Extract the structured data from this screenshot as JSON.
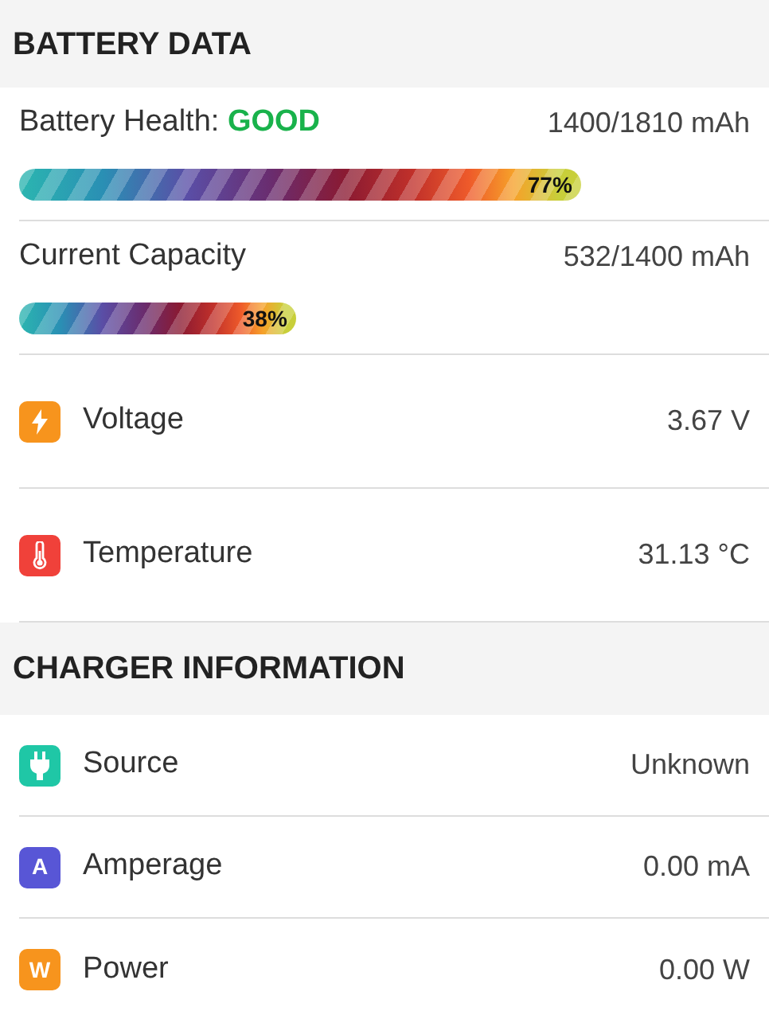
{
  "sections": [
    {
      "title": "BATTERY DATA",
      "rows": [
        {
          "kind": "meter",
          "label": "Battery Health:",
          "status": "GOOD",
          "value": "1400/1810 mAh",
          "level": 0.77,
          "reading": "77%"
        },
        {
          "kind": "meter",
          "label": "Current Capacity",
          "value": "532/1400 mAh",
          "level": 0.38,
          "reading": "38%"
        },
        {
          "kind": "item",
          "color": "#f7941d",
          "label": "Voltage",
          "value": "3.67 V"
        },
        {
          "kind": "item",
          "color": "#f0413a",
          "label": "Temperature",
          "value": "31.13 °C"
        }
      ]
    },
    {
      "title": "CHARGER INFORMATION",
      "rows": [
        {
          "kind": "item",
          "color": "#1fc7a6",
          "label": "Source",
          "value": "Unknown"
        },
        {
          "kind": "item",
          "badge": "A",
          "color": "#5856d6",
          "label": "Amperage",
          "value": "0.00 mA"
        },
        {
          "kind": "item",
          "badge": "W",
          "color": "#f7941d",
          "label": "Power",
          "value": "0.00 W"
        }
      ]
    }
  ]
}
